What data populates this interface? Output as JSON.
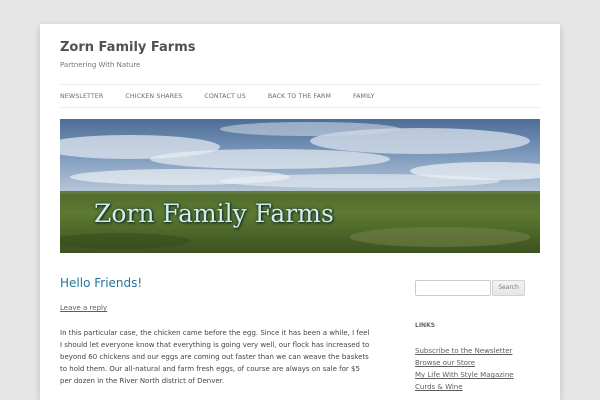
{
  "site": {
    "title": "Zorn Family Farms",
    "description": "Partnering With Nature"
  },
  "nav": {
    "items": [
      {
        "label": "NEWSLETTER"
      },
      {
        "label": "CHICKEN SHARES"
      },
      {
        "label": "CONTACT US"
      },
      {
        "label": "BACK TO THE FARM"
      },
      {
        "label": "FAMILY"
      }
    ]
  },
  "header_image": {
    "overlay_text": "Zorn Family Farms"
  },
  "post": {
    "title": "Hello Friends!",
    "leave_reply": "Leave a reply",
    "paragraphs": [
      "In this particular case, the chicken came before the egg. Since it has been a while, I feel I should let everyone know that everything is going very well, our flock has increased to beyond 60 chickens and our eggs are coming out faster than we can weave the baskets to hold them. Our all-natural and farm fresh eggs, of course are always on sale for $5 per dozen in the River North district of Denver."
    ]
  },
  "sidebar": {
    "search": {
      "placeholder": "",
      "button_label": "Search"
    },
    "links_title": "LINKS",
    "links": [
      {
        "label": "Subscribe to the Newsletter"
      },
      {
        "label": "Browse our Store"
      },
      {
        "label": "My Life With Style Magazine"
      },
      {
        "label": "Curds & Wine"
      }
    ]
  },
  "colors": {
    "background": "#e6e6e6",
    "accent_link": "#21759b",
    "text": "#444444"
  }
}
